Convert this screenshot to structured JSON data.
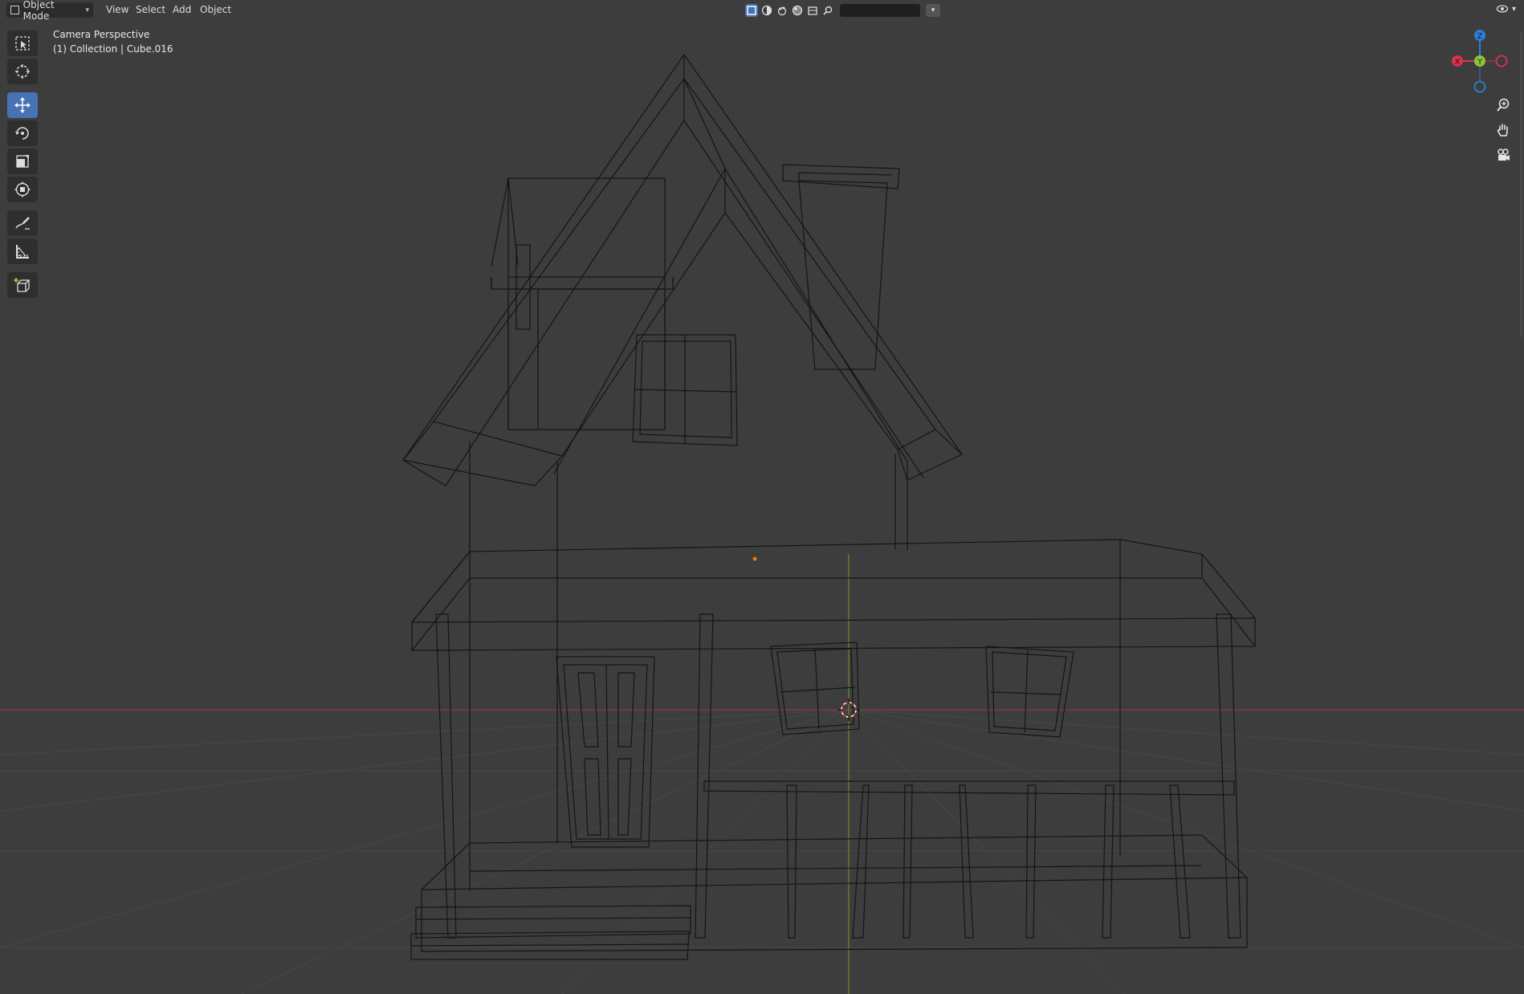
{
  "header": {
    "mode_label": "Object Mode",
    "menus": [
      "View",
      "Select",
      "Add",
      "Object"
    ]
  },
  "viewport": {
    "view_name": "Camera Perspective",
    "collection_info": "(1) Collection | Cube.016"
  },
  "gizmo": {
    "axes": [
      {
        "label": "Z",
        "color": "#2c7fd8"
      },
      {
        "label": "Y",
        "color": "#8cc43b"
      },
      {
        "label": "X",
        "color": "#d9334e"
      }
    ]
  },
  "colors": {
    "accent": "#4772b3",
    "background": "#3d3d3d",
    "x_axis_line": "#8c3c3c",
    "y_axis_line": "#6e8a2c",
    "wireframe": "#151515",
    "origin_dot": "#e87d0d"
  },
  "icons": {
    "toolbar": [
      "select-box-icon",
      "cursor-icon",
      "move-icon",
      "rotate-icon",
      "scale-icon",
      "transform-icon",
      "annotate-icon",
      "measure-icon",
      "add-cube-icon"
    ],
    "nav": [
      "zoom-icon",
      "pan-hand-icon",
      "camera-view-icon"
    ]
  }
}
